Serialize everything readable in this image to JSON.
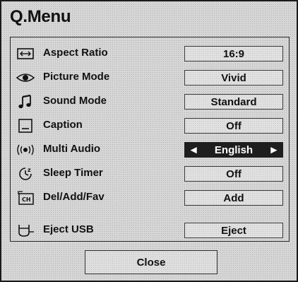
{
  "title": "Q.Menu",
  "items": [
    {
      "icon": "aspect-ratio-icon",
      "label": "Aspect Ratio",
      "value": "16:9"
    },
    {
      "icon": "eye-icon",
      "label": "Picture Mode",
      "value": "Vivid"
    },
    {
      "icon": "music-note-icon",
      "label": "Sound Mode",
      "value": "Standard"
    },
    {
      "icon": "caption-icon",
      "label": "Caption",
      "value": "Off"
    },
    {
      "icon": "audio-wave-icon",
      "label": "Multi Audio",
      "value": "English",
      "selected": true
    },
    {
      "icon": "clock-icon",
      "label": "Sleep Timer",
      "value": "Off"
    },
    {
      "icon": "channel-icon",
      "label": "Del/Add/Fav",
      "value": "Add"
    },
    {
      "icon": "usb-icon",
      "label": "Eject USB",
      "value": "Eject"
    }
  ],
  "close_label": "Close",
  "channel_icon_text": "CH"
}
